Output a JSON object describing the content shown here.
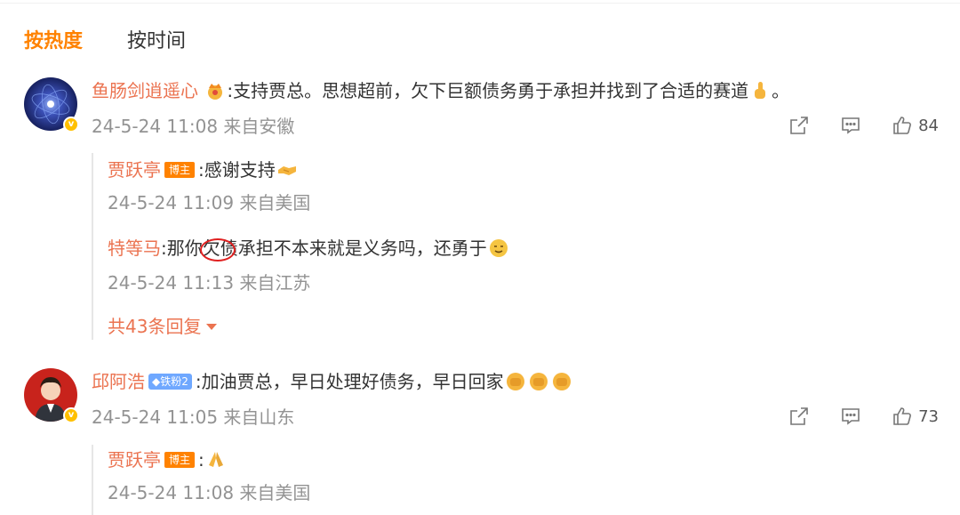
{
  "tabs": [
    {
      "label": "按热度",
      "active": true
    },
    {
      "label": "按时间",
      "active": false
    }
  ],
  "comments": [
    {
      "user": "鱼肠剑逍遥心",
      "text": ":支持贾总。思想超前，欠下巨额债务勇于承担并找到了合适的赛道",
      "text_end": "。",
      "meta": "24-5-24 11:08 来自安徽",
      "likes": "84",
      "replies": [
        {
          "user": "贾跃亭",
          "badge": "博主",
          "text": ":感谢支持",
          "meta": "24-5-24 11:09 来自美国"
        },
        {
          "user": "特等马",
          "text_a": ":那你",
          "text_b": "欠债承担不本来就是义务吗，还勇于",
          "meta": "24-5-24 11:13 来自江苏"
        }
      ],
      "more": "共43条回复"
    },
    {
      "user": "邱阿浩",
      "fan_badge": "铁粉2",
      "text": ":加油贾总，早日处理好债务，早日回家",
      "meta": "24-5-24 11:05 来自山东",
      "likes": "73",
      "replies": [
        {
          "user": "贾跃亭",
          "badge": "博主",
          "text": ":",
          "meta": "24-5-24 11:08 来自美国"
        }
      ]
    }
  ],
  "icons": {
    "share": "share-icon",
    "comment": "comment-icon",
    "like": "like-icon"
  },
  "colors": {
    "accent": "#ff8200",
    "username": "#eb7350",
    "meta": "#939393"
  }
}
